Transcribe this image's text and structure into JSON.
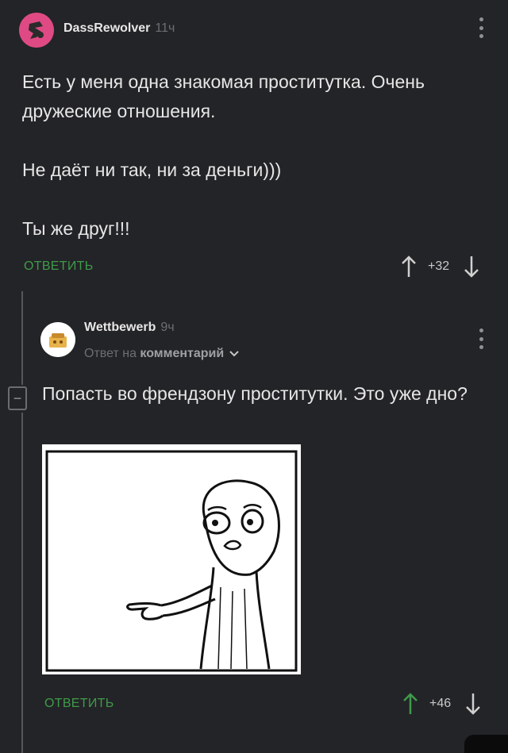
{
  "comment1": {
    "author": "DassRewolver",
    "time": "11ч",
    "paragraphs": [
      "Есть у меня одна знакомая проститутка. Очень дружеские отношения.",
      "Не даёт ни так, ни за деньги)))",
      "Ты же друг!!!"
    ],
    "reply_label": "ОТВЕТИТЬ",
    "rating": "+32"
  },
  "comment2": {
    "author": "Wettbewerb",
    "time": "9ч",
    "reply_to_prefix": "Ответ на",
    "reply_to_link": "комментарий",
    "collapse_symbol": "−",
    "text": "Попасть во френдзону проститутки. Это уже дно?",
    "reply_label": "ОТВЕТИТЬ",
    "rating": "+46"
  },
  "colors": {
    "background": "#232427",
    "reply_green": "#3f9a4b",
    "avatar1": "#d43a67"
  }
}
